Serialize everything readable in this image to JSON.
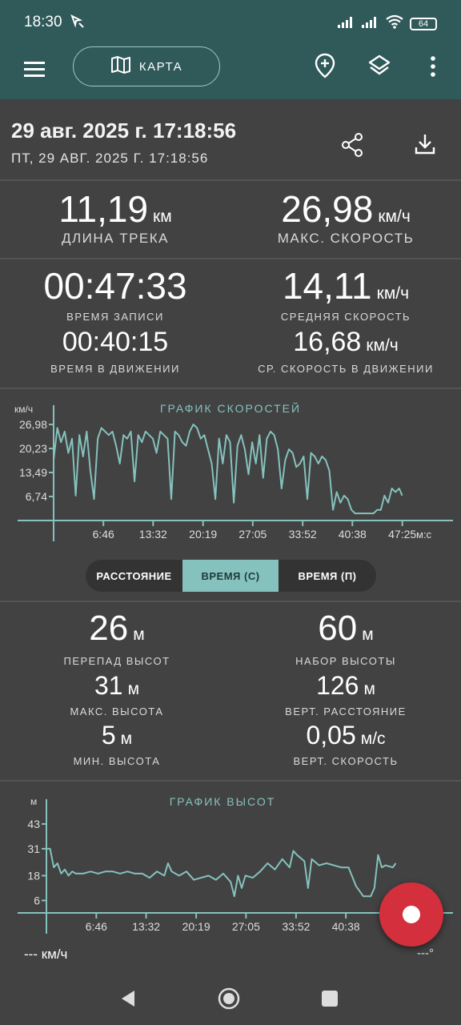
{
  "status_bar": {
    "time": "18:30",
    "battery": "64"
  },
  "app_bar": {
    "map_label": "КАРТА"
  },
  "track": {
    "date_title": "29 авг. 2025 г. 17:18:56",
    "date_subtitle": "ПТ, 29 АВГ. 2025 Г. 17:18:56"
  },
  "stats": {
    "length": {
      "value": "11,19",
      "unit": "км",
      "label": "ДЛИНА ТРЕКА"
    },
    "max_speed": {
      "value": "26,98",
      "unit": "км/ч",
      "label": "МАКС. СКОРОСТЬ"
    },
    "record_time": {
      "value": "00:47:33",
      "label": "ВРЕМЯ ЗАПИСИ"
    },
    "avg_speed": {
      "value": "14,11",
      "unit": "км/ч",
      "label": "СРЕДНЯЯ СКОРОСТЬ"
    },
    "moving_time": {
      "value": "00:40:15",
      "label": "ВРЕМЯ В ДВИЖЕНИИ"
    },
    "moving_avg_speed": {
      "value": "16,68",
      "unit": "км/ч",
      "label": "СР. СКОРОСТЬ В ДВИЖЕНИИ"
    }
  },
  "elevation": {
    "diff": {
      "value": "26",
      "unit": "м",
      "label": "ПЕРЕПАД ВЫСОТ"
    },
    "gain": {
      "value": "60",
      "unit": "м",
      "label": "НАБОР ВЫСОТЫ"
    },
    "max": {
      "value": "31",
      "unit": "м",
      "label": "МАКС. ВЫСОТА"
    },
    "vert_dist": {
      "value": "126",
      "unit": "м",
      "label": "ВЕРТ. РАССТОЯНИЕ"
    },
    "min": {
      "value": "5",
      "unit": "м",
      "label": "МИН. ВЫСОТА"
    },
    "vert_speed": {
      "value": "0,05",
      "unit": "м/с",
      "label": "ВЕРТ. СКОРОСТЬ"
    }
  },
  "segment": {
    "options": [
      "РАССТОЯНИЕ",
      "ВРЕМЯ (С)",
      "ВРЕМЯ (П)"
    ],
    "selected": "ВРЕМЯ (С)"
  },
  "bottom": {
    "speed": "--- км/ч",
    "heading": "---°"
  },
  "colors": {
    "accent": "#85c2bd",
    "appbar": "#30595a",
    "fab": "#d32f3c",
    "background": "#424242"
  },
  "icons": [
    "menu-icon",
    "map-icon",
    "add-location-icon",
    "layers-icon",
    "more-vert-icon",
    "share-icon",
    "download-icon",
    "record-icon",
    "back-icon",
    "home-icon",
    "recents-icon"
  ],
  "chart_data": [
    {
      "type": "line",
      "title": "ГРАФИК СКОРОСТЕЙ",
      "ylabel": "км/ч",
      "xlabel": "м:с",
      "x_ticks": [
        "6:46",
        "13:32",
        "20:19",
        "27:05",
        "33:52",
        "40:38",
        "47:25"
      ],
      "y_ticks": [
        "6,74",
        "13,49",
        "20,23",
        "26,98"
      ],
      "x_range_min": [
        0,
        48
      ],
      "y_range": [
        0,
        27
      ],
      "series": [
        {
          "x": [
            0.0,
            0.5,
            1.0,
            1.5,
            2.0,
            2.5,
            3.0,
            3.5,
            4.0,
            4.5,
            5.0,
            5.5,
            6.0,
            6.5,
            7.0,
            7.5,
            8.0,
            8.5,
            9.0,
            9.5,
            10.0,
            10.5,
            11.0,
            11.5,
            12.0,
            12.5,
            13.0,
            13.5,
            14.0,
            14.5,
            15.0,
            15.5,
            16.0,
            16.5,
            17.0,
            17.5,
            18.0,
            18.5,
            19.0,
            19.5,
            20.0,
            20.5,
            21.0,
            21.5,
            22.0,
            22.5,
            23.0,
            23.5,
            24.0,
            24.5,
            25.0,
            25.5,
            26.0,
            26.5,
            27.0,
            27.5,
            28.0,
            28.5,
            29.0,
            29.5,
            30.0,
            30.5,
            31.0,
            31.5,
            32.0,
            32.5,
            33.0,
            33.5,
            34.0,
            34.5,
            35.0,
            35.5,
            36.0,
            36.5,
            37.0,
            37.5,
            38.0,
            38.5,
            39.0,
            39.5,
            40.0,
            40.5,
            41.0,
            41.5,
            42.0,
            42.5,
            43.0,
            43.5,
            44.0,
            44.5,
            45.0,
            45.5,
            46.0,
            46.5,
            47.0,
            47.4
          ],
          "y": [
            17,
            26,
            22,
            25,
            19,
            23,
            7,
            24,
            18,
            25,
            14,
            6,
            23,
            26,
            25,
            24,
            25,
            21,
            16,
            24,
            23,
            25,
            11,
            24,
            22,
            25,
            24,
            23,
            19,
            25,
            24,
            23,
            6,
            25,
            24,
            22,
            21,
            25,
            27,
            26,
            23,
            24,
            20,
            16,
            6,
            23,
            16,
            24,
            22,
            5,
            21,
            24,
            20,
            13,
            22,
            16,
            24,
            12,
            23,
            25,
            24,
            20,
            9,
            17,
            20,
            19,
            15,
            16,
            18,
            6,
            19,
            18,
            16,
            18,
            17,
            14,
            3,
            8,
            5,
            7,
            6,
            3,
            2,
            2,
            2,
            2,
            2,
            2,
            3,
            3,
            7,
            5,
            9,
            8,
            9,
            7
          ]
        }
      ]
    },
    {
      "type": "line",
      "title": "ГРАФИК ВЫСОТ",
      "ylabel": "м",
      "x_ticks": [
        "6:46",
        "13:32",
        "20:19",
        "27:05",
        "33:52",
        "40:38"
      ],
      "y_ticks": [
        "6",
        "18",
        "31",
        "43"
      ],
      "x_range_min": [
        0,
        48
      ],
      "y_range": [
        0,
        48
      ],
      "series": [
        {
          "x": [
            0,
            0.5,
            1,
            1.5,
            2,
            2.5,
            3,
            3.5,
            4,
            5,
            6,
            7,
            8,
            9,
            10,
            11,
            12,
            13,
            14,
            15,
            16,
            16.5,
            17,
            18,
            19,
            20,
            21,
            22,
            23,
            24,
            25,
            25.5,
            26,
            26.5,
            27,
            28,
            29,
            30,
            31,
            32,
            33,
            33.5,
            34,
            35,
            35.5,
            36,
            37,
            38,
            39,
            40,
            41,
            42,
            43,
            44,
            44.5,
            45,
            45.5,
            46,
            47,
            47.4
          ],
          "y": [
            31,
            31,
            22,
            24,
            19,
            21,
            18,
            20,
            19,
            19,
            20,
            19,
            20,
            20,
            19,
            20,
            19,
            19,
            17,
            20,
            18,
            24,
            20,
            18,
            20,
            16,
            17,
            18,
            16,
            19,
            15,
            8,
            18,
            12,
            18,
            17,
            20,
            24,
            21,
            26,
            22,
            30,
            28,
            25,
            12,
            26,
            23,
            24,
            23,
            22,
            22,
            13,
            8,
            8,
            12,
            28,
            22,
            23,
            22,
            24
          ]
        }
      ]
    }
  ]
}
